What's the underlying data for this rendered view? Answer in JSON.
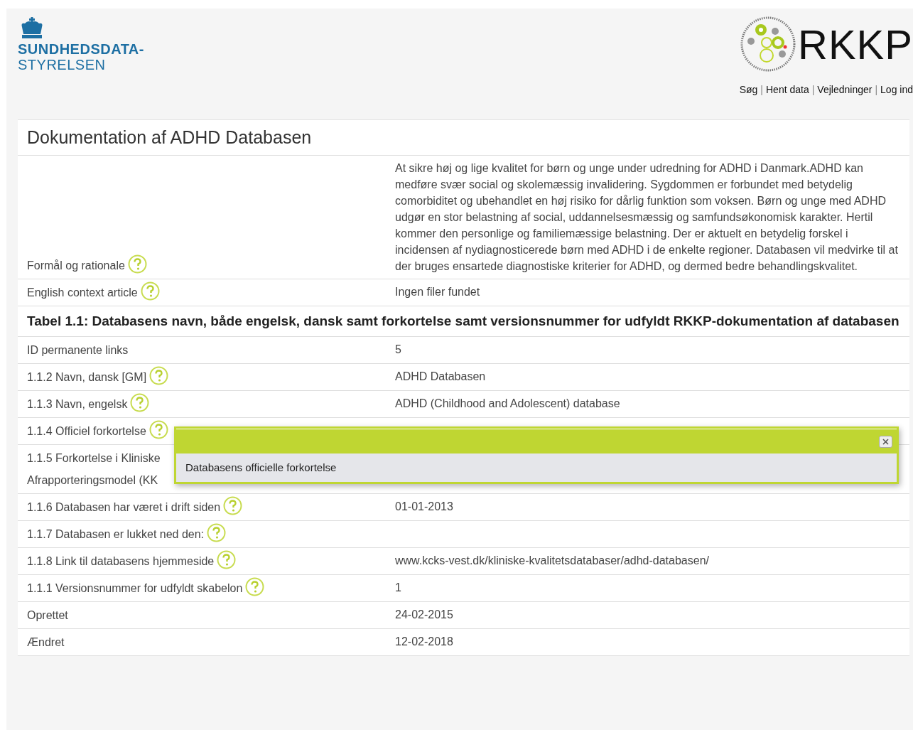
{
  "header": {
    "left_logo": {
      "line1": "SUNDHEDSDATA-",
      "line2": "STYRELSEN"
    },
    "right_logo": {
      "text": "RKKP"
    },
    "nav": [
      "Søg",
      "Hent data",
      "Vejledninger",
      "Log ind"
    ],
    "nav_separator": "|"
  },
  "page": {
    "title": "Dokumentation af ADHD Databasen",
    "rows": [
      {
        "kind": "field",
        "label": [
          "Formål og rationale"
        ],
        "help": true,
        "value": "At sikre høj og lige kvalitet for børn og unge under udredning for ADHD i Danmark.ADHD kan medføre svær social og skolemæssig invalidering. Sygdommen er forbundet med betydelig comorbiditet og ubehandlet en høj risiko for dårlig funktion som voksen. Børn og unge med ADHD udgør en stor belastning af social, uddannelsesmæssig og samfundsøkonomisk karakter. Hertil kommer den personlige og familiemæssige belastning. Der er aktuelt en betydelig forskel i incidensen af nydiagnosticerede børn med ADHD i de enkelte regioner. Databasen vil medvirke til at der bruges ensartede diagnostiske kriterier for ADHD, og dermed bedre behandlingskvalitet."
      },
      {
        "kind": "field",
        "label": [
          "English context article"
        ],
        "help": true,
        "value": "Ingen filer fundet"
      },
      {
        "kind": "heading",
        "label": [
          "Tabel 1.1: Databasens navn, både engelsk, dansk samt forkortelse samt versionsnummer for udfyldt RKKP-dokumentation af databasen"
        ]
      },
      {
        "kind": "field",
        "label": [
          "ID permanente links"
        ],
        "help": false,
        "value": "5"
      },
      {
        "kind": "field",
        "label": [
          "1.1.2 Navn, dansk [GM]"
        ],
        "help": true,
        "value": "ADHD Databasen"
      },
      {
        "kind": "field",
        "label": [
          "1.1.3 Navn, engelsk"
        ],
        "help": true,
        "value": "ADHD (Childhood and Adolescent) database"
      },
      {
        "kind": "field",
        "label": [
          "1.1.4 Officiel forkortelse"
        ],
        "help": true,
        "tooltip": {
          "text": "Databasens officielle forkortelse"
        }
      },
      {
        "kind": "field",
        "label": [
          "1.1.5 Forkortelse i Kliniske",
          "Afrapporteringsmodel (KK"
        ],
        "help": false
      },
      {
        "kind": "field",
        "label": [
          "1.1.6 Databasen har været i drift siden"
        ],
        "help": true,
        "value": "01-01-2013"
      },
      {
        "kind": "field",
        "label": [
          "1.1.7 Databasen er lukket ned den:"
        ],
        "help": true
      },
      {
        "kind": "field",
        "label": [
          "1.1.8 Link til databasens hjemmeside"
        ],
        "help": true,
        "value": "www.kcks-vest.dk/kliniske-kvalitetsdatabaser/adhd-databasen/"
      },
      {
        "kind": "field",
        "label": [
          "1.1.1 Versionsnummer for udfyldt skabelon"
        ],
        "help": true,
        "value": "1"
      },
      {
        "kind": "field",
        "label": [
          "Oprettet"
        ],
        "help": false,
        "value": "24-02-2015"
      },
      {
        "kind": "field",
        "label": [
          "Ændret"
        ],
        "help": false,
        "value": "12-02-2018"
      }
    ]
  }
}
